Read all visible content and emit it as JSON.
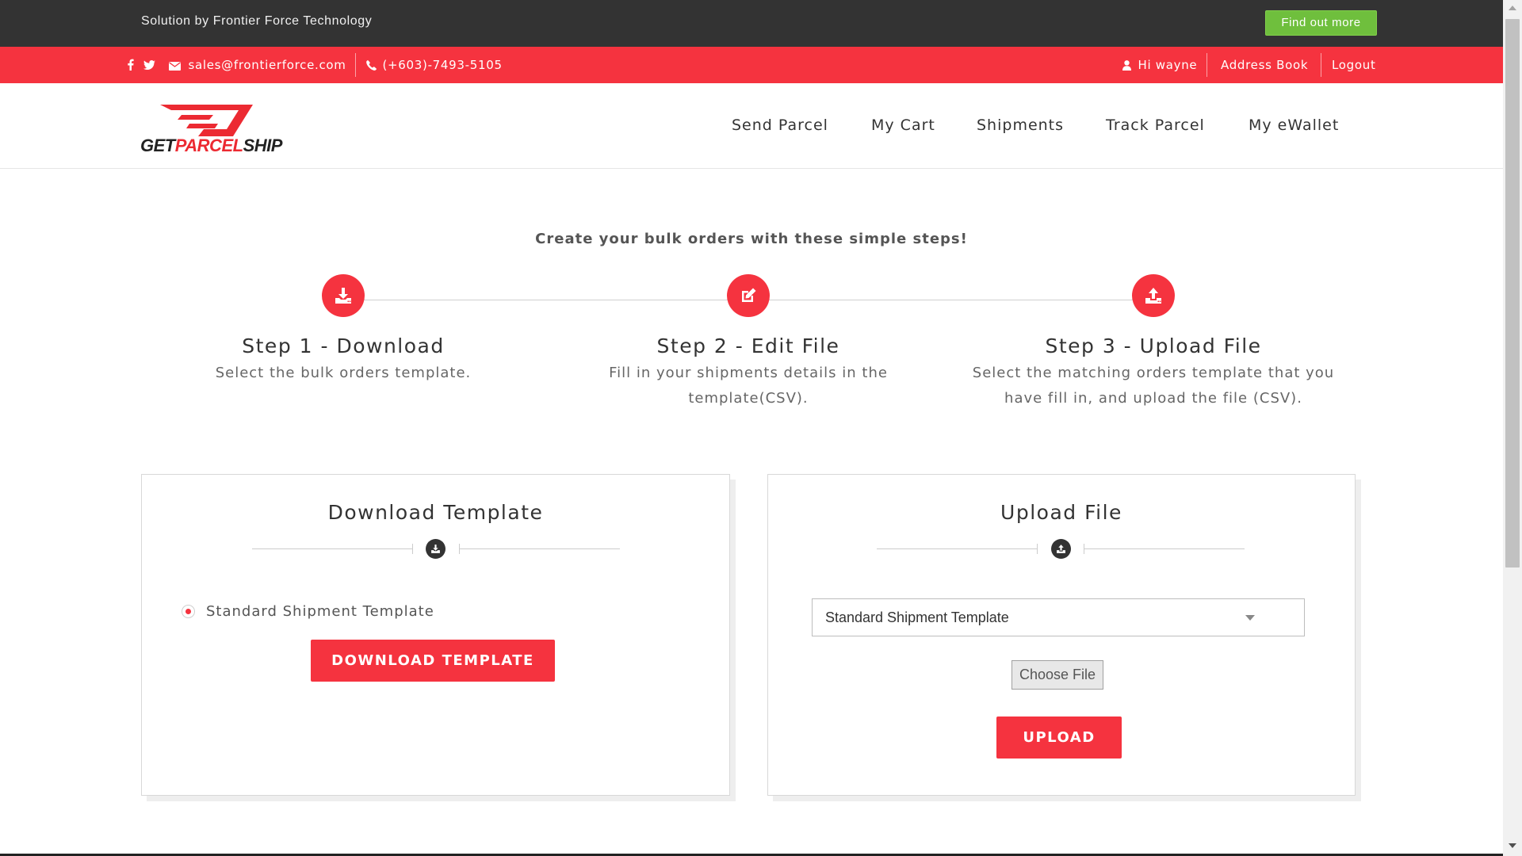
{
  "topbar": {
    "solution_text": "Solution by Frontier Force Technology",
    "find_out_label": "Find out more"
  },
  "contact": {
    "social_icons": [
      "facebook-icon",
      "twitter-icon"
    ],
    "email": "sales@frontierforce.com",
    "phone": "(+603)-7493-5105",
    "greeting": "Hi wayne",
    "address_book_label": "Address Book",
    "logout_label": "Logout"
  },
  "brand": {
    "logo_text_a": "GET",
    "logo_text_b": "PARCEL",
    "logo_text_c": "SHIP",
    "accent_color": "#f5333f",
    "dark_color": "#333333",
    "green_color": "#6fbf3d"
  },
  "nav": {
    "items": [
      "Send Parcel",
      "My Cart",
      "Shipments",
      "Track Parcel",
      "My eWallet"
    ]
  },
  "steps": {
    "title": "Create your bulk orders with these simple steps!",
    "items": [
      {
        "icon": "download-icon",
        "title": "Step 1 - Download",
        "desc_1": "Select the bulk orders template.",
        "desc_2": ""
      },
      {
        "icon": "edit-icon",
        "title": "Step 2 - Edit File",
        "desc_1": "Fill in your shipments details in the",
        "desc_2": "template(CSV)."
      },
      {
        "icon": "upload-icon",
        "title": "Step 3 - Upload File",
        "desc_1": "Select the matching orders template that you",
        "desc_2": "have fill in, and upload the file (CSV)."
      }
    ]
  },
  "download_panel": {
    "title": "Download Template",
    "radio_label": "Standard Shipment Template",
    "button_label": "DOWNLOAD TEMPLATE"
  },
  "upload_panel": {
    "title": "Upload File",
    "select_value": "Standard Shipment Template",
    "choose_file_label": "Choose File",
    "button_label": "UPLOAD"
  }
}
